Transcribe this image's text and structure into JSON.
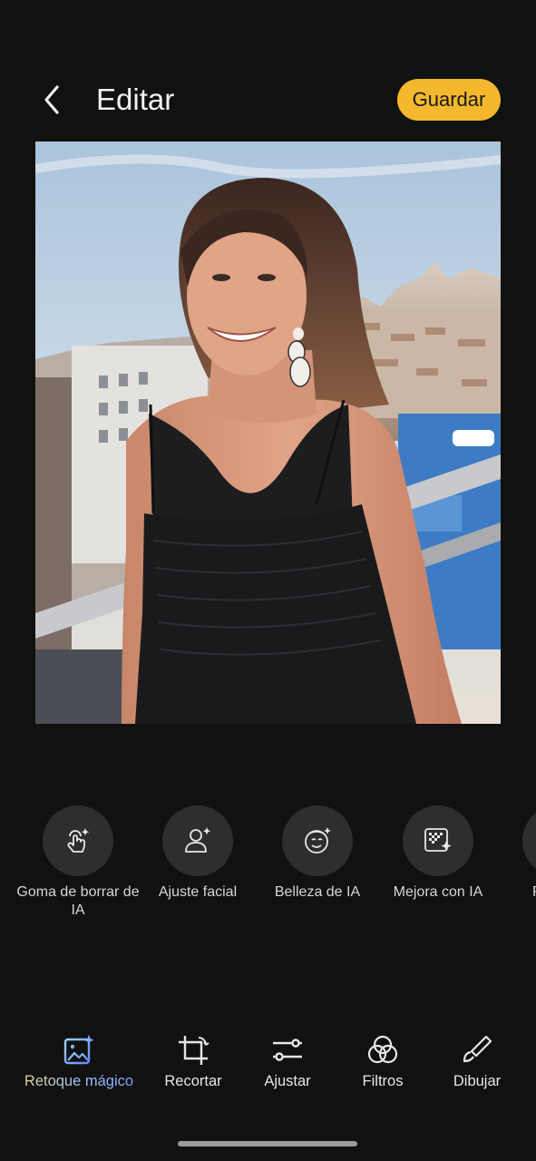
{
  "header": {
    "title": "Editar",
    "save_label": "Guardar"
  },
  "tools": [
    {
      "label": "Goma de borrar de IA",
      "icon": "ai-eraser-icon"
    },
    {
      "label": "Ajuste facial",
      "icon": "face-adjust-icon"
    },
    {
      "label": "Belleza de IA",
      "icon": "ai-beauty-icon"
    },
    {
      "label": "Mejora con IA",
      "icon": "ai-enhance-icon"
    },
    {
      "label": "Reco",
      "icon": "partial-tool-icon"
    }
  ],
  "nav": [
    {
      "label": "Retoque mágico",
      "icon": "magic-retouch-icon",
      "active": true
    },
    {
      "label": "Recortar",
      "icon": "crop-icon"
    },
    {
      "label": "Ajustar",
      "icon": "adjust-sliders-icon"
    },
    {
      "label": "Filtros",
      "icon": "filters-icon"
    },
    {
      "label": "Dibujar",
      "icon": "brush-icon"
    }
  ],
  "colors": {
    "background": "#111111",
    "accent": "#f4b82e",
    "chip": "#2e2e2e"
  }
}
